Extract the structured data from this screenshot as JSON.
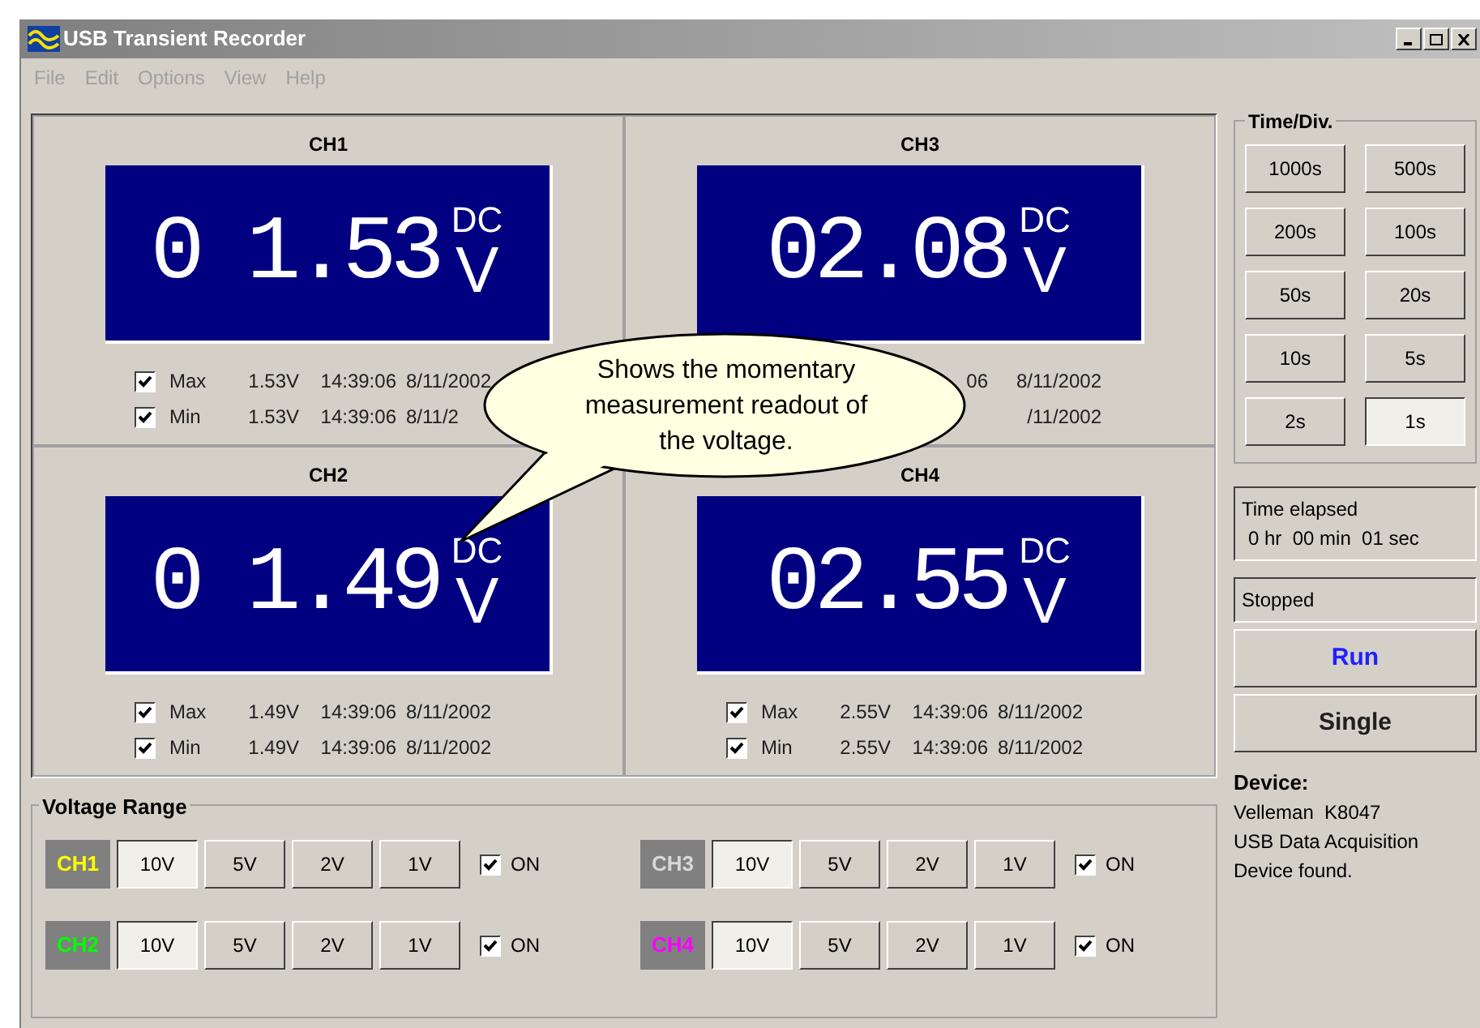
{
  "window": {
    "title": "USB Transient Recorder"
  },
  "menu": [
    "File",
    "Edit",
    "Options",
    "View",
    "Help"
  ],
  "channels": [
    {
      "name": "CH1",
      "reading": "0 1.53",
      "coupling": "DC",
      "unit": "V",
      "stats": [
        {
          "label": "Max",
          "checked": true,
          "value": "1.53V",
          "time": "14:39:06",
          "date": "8/11/2002"
        },
        {
          "label": "Min",
          "checked": true,
          "value": "1.53V",
          "time": "14:39:06",
          "date": "8/11/2"
        }
      ]
    },
    {
      "name": "CH3",
      "reading": "02.08",
      "coupling": "DC",
      "unit": "V",
      "stats": [
        {
          "time": "06",
          "date": "8/11/2002"
        },
        {
          "date": "/11/2002"
        }
      ]
    },
    {
      "name": "CH2",
      "reading": "0 1.49",
      "coupling": "DC",
      "unit": "V",
      "stats": [
        {
          "label": "Max",
          "checked": true,
          "value": "1.49V",
          "time": "14:39:06",
          "date": "8/11/2002"
        },
        {
          "label": "Min",
          "checked": true,
          "value": "1.49V",
          "time": "14:39:06",
          "date": "8/11/2002"
        }
      ]
    },
    {
      "name": "CH4",
      "reading": "02.55",
      "coupling": "DC",
      "unit": "V",
      "stats": [
        {
          "label": "Max",
          "checked": true,
          "value": "2.55V",
          "time": "14:39:06",
          "date": "8/11/2002"
        },
        {
          "label": "Min",
          "checked": true,
          "value": "2.55V",
          "time": "14:39:06",
          "date": "8/11/2002"
        }
      ]
    }
  ],
  "callout": {
    "text": "Shows the momentary measurement readout of the voltage."
  },
  "voltage_range": {
    "title": "Voltage Range",
    "channels": [
      {
        "name": "CH1",
        "color": "#ffff00",
        "ranges": [
          {
            "label": "10V",
            "selected": true
          },
          {
            "label": "5V",
            "selected": false
          },
          {
            "label": "2V",
            "selected": false
          },
          {
            "label": "1V",
            "selected": false
          }
        ],
        "on": {
          "label": "ON",
          "checked": true
        }
      },
      {
        "name": "CH3",
        "color": "#d8d8d8",
        "ranges": [
          {
            "label": "10V",
            "selected": true
          },
          {
            "label": "5V",
            "selected": false
          },
          {
            "label": "2V",
            "selected": false
          },
          {
            "label": "1V",
            "selected": false
          }
        ],
        "on": {
          "label": "ON",
          "checked": true
        }
      },
      {
        "name": "CH2",
        "color": "#00ff00",
        "ranges": [
          {
            "label": "10V",
            "selected": true
          },
          {
            "label": "5V",
            "selected": false
          },
          {
            "label": "2V",
            "selected": false
          },
          {
            "label": "1V",
            "selected": false
          }
        ],
        "on": {
          "label": "ON",
          "checked": true
        }
      },
      {
        "name": "CH4",
        "color": "#ff00ff",
        "ranges": [
          {
            "label": "10V",
            "selected": true
          },
          {
            "label": "5V",
            "selected": false
          },
          {
            "label": "2V",
            "selected": false
          },
          {
            "label": "1V",
            "selected": false
          }
        ],
        "on": {
          "label": "ON",
          "checked": true
        }
      }
    ]
  },
  "time_div": {
    "title": "Time/Div.",
    "options": [
      {
        "label": "1000s",
        "selected": false
      },
      {
        "label": "500s",
        "selected": false
      },
      {
        "label": "200s",
        "selected": false
      },
      {
        "label": "100s",
        "selected": false
      },
      {
        "label": "50s",
        "selected": false
      },
      {
        "label": "20s",
        "selected": false
      },
      {
        "label": "10s",
        "selected": false
      },
      {
        "label": "5s",
        "selected": false
      },
      {
        "label": "2s",
        "selected": false
      },
      {
        "label": "1s",
        "selected": true
      }
    ]
  },
  "status": {
    "elapsed_label": "Time elapsed",
    "elapsed": "0 hr  00 min  01 sec",
    "state": "Stopped"
  },
  "actions": [
    {
      "label": "Run",
      "kind": "primary"
    },
    {
      "label": "Single",
      "kind": "normal"
    }
  ],
  "device": {
    "title": "Device:",
    "lines": [
      "Velleman  K8047",
      "USB Data Acquisition",
      "Device found."
    ]
  }
}
